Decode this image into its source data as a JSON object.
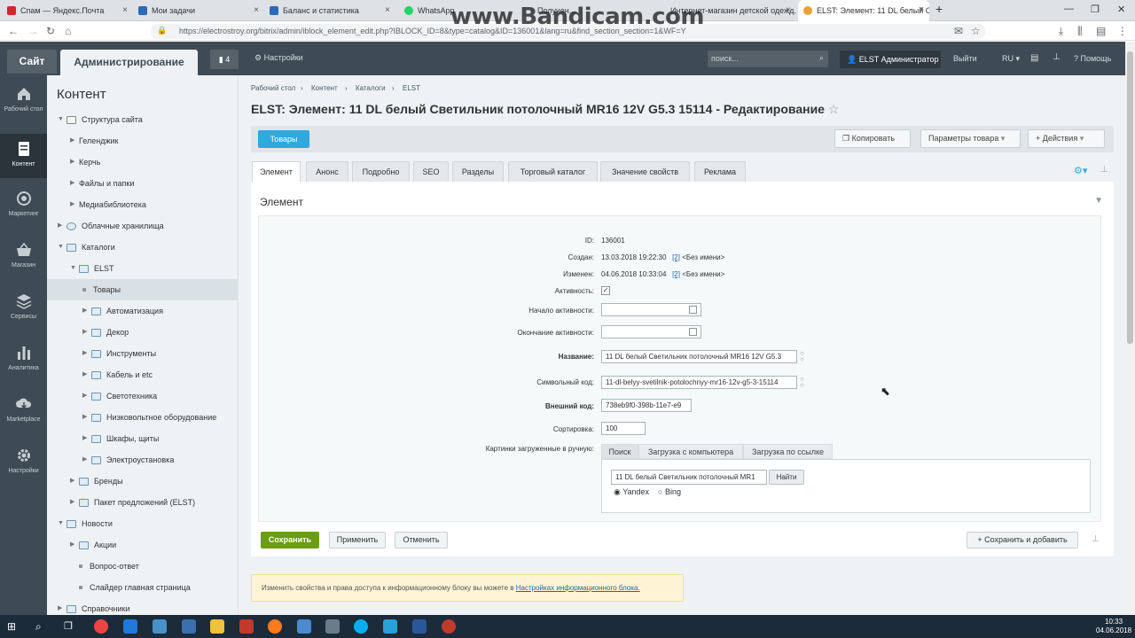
{
  "browser": {
    "tabs": [
      {
        "label": "Спам — Яндекс.Почта",
        "color": "#d9232d"
      },
      {
        "label": "Мои задачи",
        "color": "#2b6bb7"
      },
      {
        "label": "Баланс и статистика",
        "color": "#2b6bb7"
      },
      {
        "label": "WhatsApp",
        "color": "#25d366"
      },
      {
        "label": "Получен...",
        "color": "#888888"
      },
      {
        "label": "Интернет-магазин детской одежд...",
        "color": "#888888"
      },
      {
        "label": "ELST: Элемент: 11 DL белый С...",
        "color": "#e8a13a"
      }
    ],
    "url": "https://electrostroy.org/bitrix/admin/iblock_element_edit.php?IBLOCK_ID=8&type=catalog&ID=136001&lang=ru&find_section_section=1&WF=Y",
    "watermark": "www.Bandicam.com"
  },
  "topbar": {
    "site": "Сайт",
    "admin": "Администрирование",
    "notifications": "4",
    "settings": "Настройки",
    "search_placeholder": "поиск...",
    "user": "ELST Администратор",
    "exit": "Выйти",
    "lang": "RU",
    "help": "Помощь"
  },
  "leftmenu": [
    {
      "label": "Рабочий стол",
      "icon": "home-icon"
    },
    {
      "label": "Контент",
      "icon": "document-icon",
      "active": true
    },
    {
      "label": "Маркетинг",
      "icon": "target-icon"
    },
    {
      "label": "Магазин",
      "icon": "basket-icon"
    },
    {
      "label": "Сервисы",
      "icon": "layers-icon"
    },
    {
      "label": "Аналитика",
      "icon": "bar-chart-icon"
    },
    {
      "label": "Marketplace",
      "icon": "cloud-download-icon"
    },
    {
      "label": "Настройки",
      "icon": "gear-icon"
    }
  ],
  "tree": {
    "title": "Контент",
    "items": [
      {
        "label": "Структура сайта"
      },
      {
        "label": "Геленджик"
      },
      {
        "label": "Керчь"
      },
      {
        "label": "Файлы и папки"
      },
      {
        "label": "Медиабиблиотека"
      },
      {
        "label": "Облачные хранилища"
      },
      {
        "label": "Каталоги"
      },
      {
        "label": "ELST"
      },
      {
        "label": "Товары",
        "selected": true
      },
      {
        "label": "Автоматизация"
      },
      {
        "label": "Декор"
      },
      {
        "label": "Инструменты"
      },
      {
        "label": "Кабель и etc"
      },
      {
        "label": "Светотехника"
      },
      {
        "label": "Низковольтное оборудование"
      },
      {
        "label": "Шкафы, щиты"
      },
      {
        "label": "Электроустановка"
      },
      {
        "label": "Бренды"
      },
      {
        "label": "Пакет предложений (ELST)"
      },
      {
        "label": "Новости"
      },
      {
        "label": "Акции"
      },
      {
        "label": "Вопрос-ответ"
      },
      {
        "label": "Слайдер главная страница"
      },
      {
        "label": "Справочники"
      }
    ]
  },
  "main": {
    "breadcrumbs": [
      "Рабочий стол",
      "Контент",
      "Каталоги",
      "ELST"
    ],
    "title": "ELST: Элемент: 11 DL белый Светильник потолочный MR16 12V G5.3 15114 - Редактирование",
    "toolbar": {
      "section": "Товары",
      "copy": "Копировать",
      "params": "Параметры товара",
      "actions": "Действия"
    },
    "tabs": [
      "Элемент",
      "Анонс",
      "Подробно",
      "SEO",
      "Разделы",
      "Торговый каталог",
      "Значение свойств",
      "Реклама"
    ],
    "panel_title": "Элемент",
    "fields": {
      "id_label": "ID:",
      "id": "136001",
      "created_label": "Создан:",
      "created": "13.03.2018 19:22:30",
      "created_user": "[2]",
      "created_name": "<Без имени>",
      "modified_label": "Изменен:",
      "modified": "04.06.2018 10:33:04",
      "modified_user": "[2]",
      "modified_name": "<Без имени>",
      "active_label": "Активность:",
      "active": "true",
      "start_label": "Начало активности:",
      "end_label": "Окончание активности:",
      "name_label": "Название:",
      "name": "11 DL белый Светильник потолочный MR16 12V G5.3",
      "code_label": "Символьный код:",
      "code": "11-dl-belyy-svetilnik-potolochnyy-mr16-12v-g5-3-15114",
      "ext_label": "Внешний код:",
      "ext": "738eb9f0-398b-11e7-e9",
      "sort_label": "Сортировка:",
      "sort": "100",
      "pics_label": "Картинки загруженные в ручную:"
    },
    "pic_tabs": [
      "Поиск",
      "Загрузка с компьютера",
      "Загрузка по ссылке"
    ],
    "pic_search": {
      "query": "11 DL белый Светильник потолочный MR1",
      "find": "Найти",
      "engines": [
        "Yandex",
        "Bing"
      ]
    },
    "buttons": {
      "save": "Сохранить",
      "apply": "Применить",
      "cancel": "Отменить",
      "save_add": "Сохранить и добавить"
    },
    "note": {
      "text": "Изменить свойства и права доступа к информационному блоку вы можете в",
      "link": "Настройках информационного блока."
    }
  },
  "taskbar": {
    "time": "10:33",
    "date": "04.06.2018"
  }
}
